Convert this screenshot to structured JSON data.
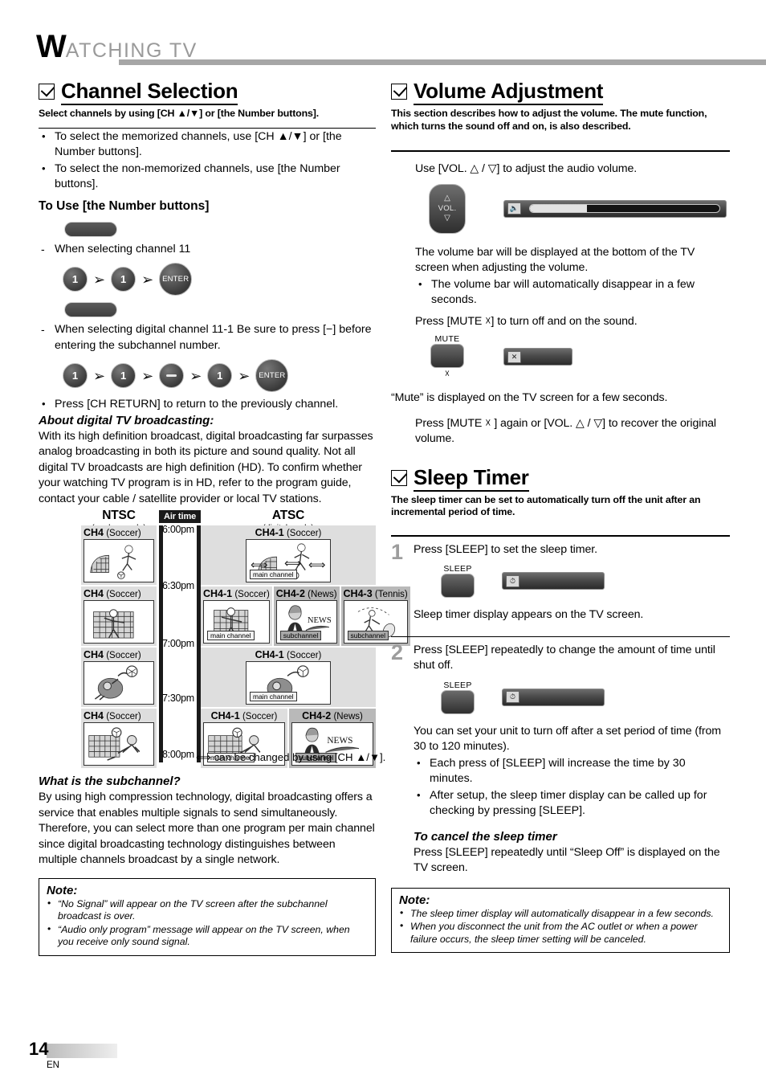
{
  "header": {
    "drop_cap": "W",
    "rest": "ATCHING  TV"
  },
  "left": {
    "section": {
      "title": "Channel Selection",
      "subtitle": "Select channels by using [CH ▲/▼] or [the Number buttons]."
    },
    "bullets": [
      "To select the memorized channels, use [CH ▲/▼] or [the Number buttons].",
      "To select the non-memorized channels, use [the Number buttons]."
    ],
    "number_buttons_head": "To Use [the Number buttons]",
    "case1": {
      "dash": "When selecting channel 11",
      "keys": [
        "1",
        "1",
        "ENTER"
      ]
    },
    "case2": {
      "dash": "When selecting digital channel 11-1 Be sure to press [−] before entering the subchannel number.",
      "keys": [
        "1",
        "1",
        "−",
        "1",
        "ENTER"
      ]
    },
    "ch_return_bullet": "Press [CH RETURN] to return to the previously channel.",
    "about_head": "About digital TV broadcasting:",
    "about_body": "With its high definition broadcast, digital broadcasting far surpasses analog broadcasting in both its picture and sound quality. Not all digital TV broadcasts are high definition (HD). To confirm whether your watching TV program is in HD, refer to the program guide, contact your cable / satellite provider or local TV stations.",
    "diagram": {
      "ntsc_title": "NTSC",
      "ntsc_sub": "(analog mode)",
      "atsc_title": "ATSC",
      "atsc_sub": "(digital mode)",
      "airtime_label": "Air time",
      "times": [
        "6:00pm",
        "6:30pm",
        "7:00pm",
        "7:30pm",
        "8:00pm"
      ],
      "ntsc_cells": [
        {
          "ch": "CH4",
          "prog": "(Soccer)"
        },
        {
          "ch": "CH4",
          "prog": "(Soccer)"
        },
        {
          "ch": "CH4",
          "prog": "(Soccer)"
        },
        {
          "ch": "CH4",
          "prog": "(Soccer)"
        }
      ],
      "atsc_rows": [
        {
          "cells": [
            {
              "ch": "CH4-1",
              "prog": "(Soccer)",
              "tag": "main channel"
            }
          ]
        },
        {
          "cells": [
            {
              "ch": "CH4-1",
              "prog": "(Soccer)",
              "tag": "main channel"
            },
            {
              "ch": "CH4-2",
              "prog": "(News)",
              "tag": "subchannel"
            },
            {
              "ch": "CH4-3",
              "prog": "(Tennis)",
              "tag": "subchannel"
            }
          ]
        },
        {
          "cells": [
            {
              "ch": "CH4-1",
              "prog": "(Soccer)",
              "tag": "main channel"
            }
          ]
        },
        {
          "cells": [
            {
              "ch": "CH4-1",
              "prog": "(Soccer)",
              "tag": "main channel"
            },
            {
              "ch": "CH4-2",
              "prog": "(News)",
              "tag": "subchannel"
            }
          ]
        }
      ],
      "footnote": "⟺ can be changed by using [CH ▲/▼]."
    },
    "sub_head": "What is the subchannel?",
    "sub_body": "By using high compression technology, digital broadcasting offers a service that enables multiple signals to send simultaneously. Therefore, you can select more than one program per main channel since digital broadcasting technology distinguishes between multiple channels broadcast by a single network.",
    "note": {
      "title": "Note:",
      "items": [
        "“No Signal” will appear on the TV screen after the subchannel broadcast is over.",
        "“Audio only program” message will appear on the TV screen, when you receive only sound signal."
      ]
    }
  },
  "right": {
    "volume": {
      "title": "Volume Adjustment",
      "subtitle": "This section describes how to adjust the volume. The mute function, which turns the sound off and on, is also described.",
      "use_line": "Use [VOL. △ / ▽] to adjust the audio volume.",
      "rocker": {
        "up": "△",
        "label": "VOL.",
        "down": "▽"
      },
      "osd_volume": {
        "icon": "speaker-icon",
        "fill_percent": 30
      },
      "para1": "The volume bar will be displayed at the bottom of the TV screen when adjusting the volume.",
      "bullet1": "The volume bar will automatically disappear in a few seconds.",
      "mute_line": "Press [MUTE ☓] to turn off and on the sound.",
      "mute_btn_cap": "MUTE",
      "mute_btn_sub": "☓",
      "osd_mute": {
        "icon": "mute-icon"
      },
      "mute_msg": "“Mute” is displayed on the TV screen for a few seconds.",
      "recover": "Press [MUTE ☓ ] again or [VOL. △ / ▽] to recover the original volume."
    },
    "sleep": {
      "title": "Sleep Timer",
      "subtitle": "The sleep timer can be set to automatically turn off the unit after an incremental period of time.",
      "steps": [
        {
          "num": "1",
          "text": "Press [SLEEP] to set the sleep timer.",
          "btn_cap": "SLEEP",
          "osd": {
            "icon": "timer-icon"
          },
          "after": "Sleep timer display appears on the TV screen."
        },
        {
          "num": "2",
          "text": "Press [SLEEP] repeatedly to change the amount of time until shut off.",
          "btn_cap": "SLEEP",
          "osd": {
            "icon": "timer-icon"
          },
          "after": "You can set your unit to turn off after a set period of time (from 30 to 120 minutes)."
        }
      ],
      "bullets": [
        "Each press of [SLEEP] will increase the time by 30 minutes.",
        "After setup, the sleep timer display can be called up for checking by pressing [SLEEP]."
      ],
      "cancel_head": "To cancel the sleep timer",
      "cancel_body": "Press [SLEEP] repeatedly until “Sleep Off” is displayed on the TV screen.",
      "note": {
        "title": "Note:",
        "items": [
          "The sleep timer display will automatically disappear in a few seconds.",
          "When you disconnect the unit from the AC outlet or when a power failure occurs, the sleep timer setting will be canceled."
        ]
      }
    }
  },
  "footer": {
    "page_number": "14",
    "language": "EN"
  }
}
